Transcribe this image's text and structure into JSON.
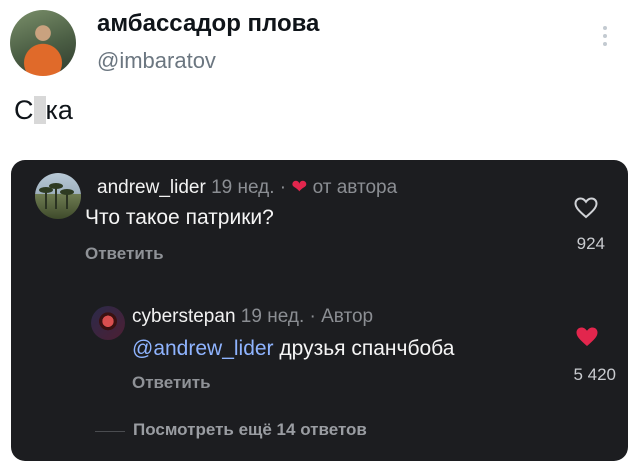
{
  "tweet": {
    "author_name": "амбассадор плова",
    "author_handle": "@imbaratov",
    "text_prefix": "С",
    "text_suffix": "ка"
  },
  "comment": {
    "username": "andrew_lider",
    "time": "19 нед.",
    "separator": "·",
    "author_badge": "от автора",
    "text": "Что такое патрики?",
    "reply_label": "Ответить",
    "likes": "924"
  },
  "reply": {
    "username": "cyberstepan",
    "time": "19 нед.",
    "separator": "·",
    "author_badge": "Автор",
    "mention": "@andrew_lider",
    "text": " друзья спанчбоба",
    "reply_label": "Ответить",
    "likes": "5 420"
  },
  "more_replies": "Посмотреть ещё 14 ответов",
  "colors": {
    "card_bg": "#1c1d20",
    "like_red": "#e2264d",
    "mention_blue": "#8fb4ff"
  },
  "icons": [
    "more-vertical-icon",
    "heart-outline-icon",
    "heart-filled-icon"
  ]
}
